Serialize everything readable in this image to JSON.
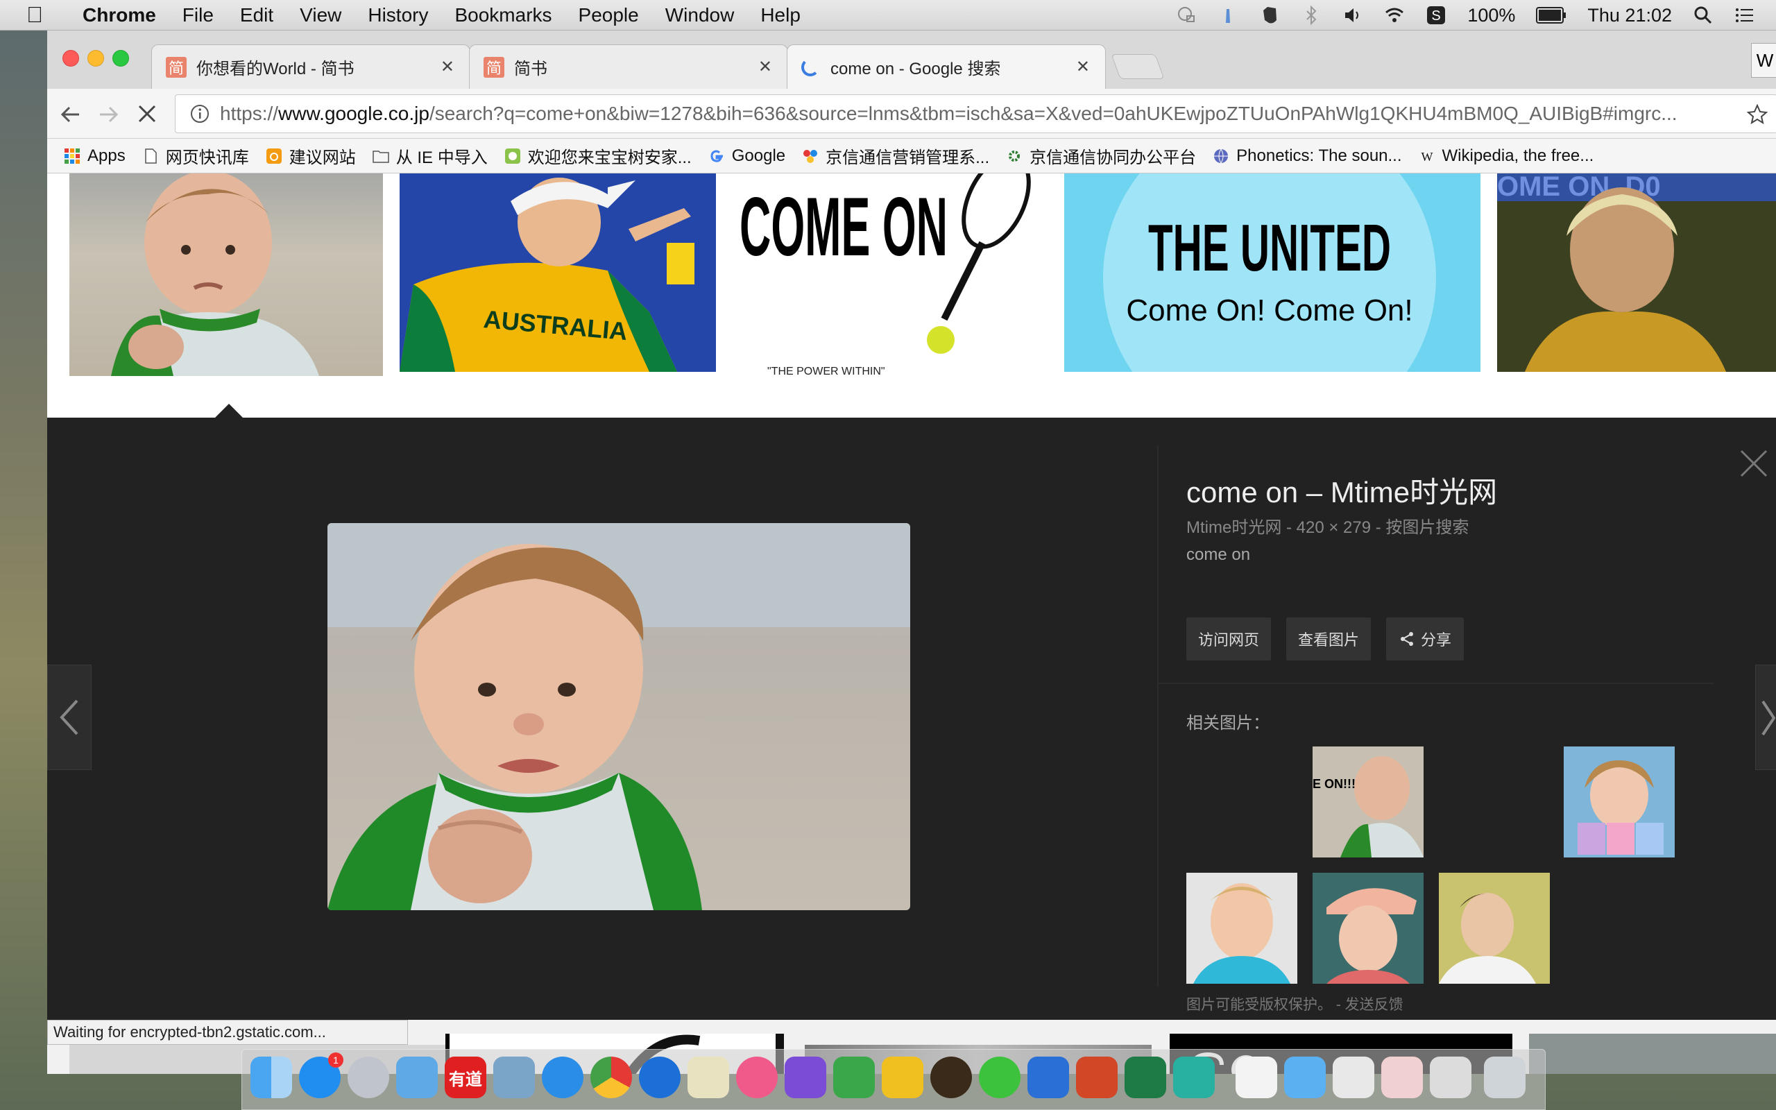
{
  "menubar": {
    "app": "Chrome",
    "items": [
      "File",
      "Edit",
      "View",
      "History",
      "Bookmarks",
      "People",
      "Window",
      "Help"
    ],
    "battery": "100%",
    "clock": "Thu 21:02"
  },
  "tabs": [
    {
      "title": "你想看的World - 简书",
      "favicon": "简"
    },
    {
      "title": "简书",
      "favicon": "简"
    },
    {
      "title": "come on - Google 搜索",
      "favicon": "loading"
    }
  ],
  "profile_initial": "W",
  "address": {
    "scheme": "https://",
    "domain": "www.google.co.jp",
    "path": "/search?q=come+on&biw=1278&bih=636&source=lnms&tbm=isch&sa=X&ved=0ahUKEwjpoZTUuOnPAhWlg1QKHU4mBM0Q_AUIBigB#imgrc..."
  },
  "bookmarks": [
    {
      "label": "Apps",
      "icon": "apps-grid-icon"
    },
    {
      "label": "网页快讯库",
      "icon": "page-icon"
    },
    {
      "label": "建议网站",
      "icon": "suggested-sites-icon"
    },
    {
      "label": "从 IE 中导入",
      "icon": "folder-icon"
    },
    {
      "label": "欢迎您来宝宝树安家...",
      "icon": "babytree-icon"
    },
    {
      "label": "Google",
      "icon": "google-icon"
    },
    {
      "label": "京信通信营销管理系...",
      "icon": "colorful-dots-icon"
    },
    {
      "label": "京信通信协同办公平台",
      "icon": "gear-green-icon"
    },
    {
      "label": "Phonetics: The soun...",
      "icon": "globe-icon"
    },
    {
      "label": "Wikipedia, the free...",
      "icon": "wikipedia-icon"
    }
  ],
  "results_row": [
    {
      "label": "baby-fist"
    },
    {
      "label": "AUSTRALIA"
    },
    {
      "title": "COME ON",
      "tagline": "\"THE POWER WITHIN\""
    },
    {
      "title": "THE UNITED",
      "subtitle": "Come On! Come On!"
    },
    {
      "label": "OME ON, D0"
    }
  ],
  "preview": {
    "title": "come on – Mtime时光网",
    "meta": "Mtime时光网 - 420 × 279 - 按图片搜索",
    "caption": "come on",
    "buttons": [
      "访问网页",
      "查看图片",
      "分享"
    ],
    "related_label": "相关图片：",
    "related_thumb_text": "E ON!!!",
    "footer": "图片可能受版权保护。 - 发送反馈"
  },
  "status": "Waiting for encrypted-tbn2.gstatic.com...",
  "dock": {
    "badge": "1",
    "youdao": "有道"
  }
}
